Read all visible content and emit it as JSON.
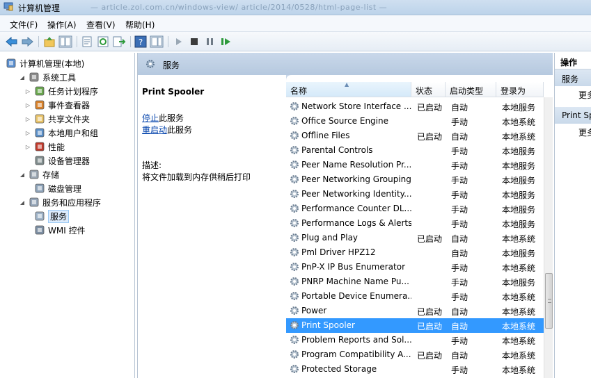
{
  "window": {
    "title": "计算机管理",
    "ghost_text": "— article.zol.com.cn/windows-view/ article/2014/0528/html-page-list —"
  },
  "menu": [
    {
      "label": "文件(F)"
    },
    {
      "label": "操作(A)"
    },
    {
      "label": "查看(V)"
    },
    {
      "label": "帮助(H)"
    }
  ],
  "toolbar": {
    "icons": [
      "back-arrow-icon",
      "forward-arrow-icon",
      "up-folder-icon",
      "show-hide-tree-icon",
      "properties-icon",
      "refresh-icon",
      "export-list-icon",
      "help-icon",
      "show-hide-action-pane-icon",
      "start-icon",
      "stop-icon",
      "pause-icon",
      "resume-icon"
    ]
  },
  "tree": [
    {
      "label": "计算机管理(本地)",
      "icon": "computer-management-icon",
      "level": 0,
      "toggle": ""
    },
    {
      "label": "系统工具",
      "icon": "system-tools-icon",
      "level": 1,
      "toggle": "◢"
    },
    {
      "label": "任务计划程序",
      "icon": "task-scheduler-icon",
      "level": 2,
      "toggle": "▷"
    },
    {
      "label": "事件查看器",
      "icon": "event-viewer-icon",
      "level": 2,
      "toggle": "▷"
    },
    {
      "label": "共享文件夹",
      "icon": "shared-folders-icon",
      "level": 2,
      "toggle": "▷"
    },
    {
      "label": "本地用户和组",
      "icon": "local-users-icon",
      "level": 2,
      "toggle": "▷"
    },
    {
      "label": "性能",
      "icon": "performance-icon",
      "level": 2,
      "toggle": "▷"
    },
    {
      "label": "设备管理器",
      "icon": "device-manager-icon",
      "level": 2,
      "toggle": ""
    },
    {
      "label": "存储",
      "icon": "storage-icon",
      "level": 1,
      "toggle": "◢"
    },
    {
      "label": "磁盘管理",
      "icon": "disk-management-icon",
      "level": 2,
      "toggle": ""
    },
    {
      "label": "服务和应用程序",
      "icon": "services-apps-icon",
      "level": 1,
      "toggle": "◢"
    },
    {
      "label": "服务",
      "icon": "services-gear-icon",
      "level": 2,
      "toggle": "",
      "selected": true
    },
    {
      "label": "WMI 控件",
      "icon": "wmi-control-icon",
      "level": 2,
      "toggle": ""
    }
  ],
  "services_header": {
    "title": "服务"
  },
  "detail": {
    "service_name": "Print Spooler",
    "stop_link": "停止",
    "stop_suffix": "此服务",
    "restart_link": "重启动",
    "restart_suffix": "此服务",
    "desc_label": "描述:",
    "desc_text": "将文件加载到内存供稍后打印"
  },
  "columns": [
    {
      "label": "名称",
      "sorted": true
    },
    {
      "label": "状态"
    },
    {
      "label": "启动类型"
    },
    {
      "label": "登录为"
    }
  ],
  "services": [
    {
      "name": "Network Store Interface ...",
      "status": "已启动",
      "startup": "自动",
      "logon": "本地服务"
    },
    {
      "name": "Office Source Engine",
      "status": "",
      "startup": "手动",
      "logon": "本地系统"
    },
    {
      "name": "Offline Files",
      "status": "已启动",
      "startup": "自动",
      "logon": "本地系统"
    },
    {
      "name": "Parental Controls",
      "status": "",
      "startup": "手动",
      "logon": "本地服务"
    },
    {
      "name": "Peer Name Resolution Pr...",
      "status": "",
      "startup": "手动",
      "logon": "本地服务"
    },
    {
      "name": "Peer Networking Grouping",
      "status": "",
      "startup": "手动",
      "logon": "本地服务"
    },
    {
      "name": "Peer Networking Identity...",
      "status": "",
      "startup": "手动",
      "logon": "本地服务"
    },
    {
      "name": "Performance Counter DL...",
      "status": "",
      "startup": "手动",
      "logon": "本地服务"
    },
    {
      "name": "Performance Logs & Alerts",
      "status": "",
      "startup": "手动",
      "logon": "本地服务"
    },
    {
      "name": "Plug and Play",
      "status": "已启动",
      "startup": "自动",
      "logon": "本地系统"
    },
    {
      "name": "Pml Driver HPZ12",
      "status": "",
      "startup": "自动",
      "logon": "本地服务"
    },
    {
      "name": "PnP-X IP Bus Enumerator",
      "status": "",
      "startup": "手动",
      "logon": "本地系统"
    },
    {
      "name": "PNRP Machine Name Pu...",
      "status": "",
      "startup": "手动",
      "logon": "本地服务"
    },
    {
      "name": "Portable Device Enumera...",
      "status": "",
      "startup": "手动",
      "logon": "本地系统"
    },
    {
      "name": "Power",
      "status": "已启动",
      "startup": "自动",
      "logon": "本地系统"
    },
    {
      "name": "Print Spooler",
      "status": "已启动",
      "startup": "自动",
      "logon": "本地系统",
      "selected": true
    },
    {
      "name": "Problem Reports and Sol...",
      "status": "",
      "startup": "手动",
      "logon": "本地系统"
    },
    {
      "name": "Program Compatibility A...",
      "status": "已启动",
      "startup": "自动",
      "logon": "本地系统"
    },
    {
      "name": "Protected Storage",
      "status": "",
      "startup": "手动",
      "logon": "本地系统"
    }
  ],
  "actions": {
    "header": "操作",
    "sections": [
      {
        "title": "服务",
        "item": "更多"
      },
      {
        "title": "Print Sp",
        "item": "更多"
      }
    ]
  },
  "colors": {
    "selection": "#3399ff",
    "header_blue": "#c9d8ea",
    "link": "#0645ad"
  }
}
